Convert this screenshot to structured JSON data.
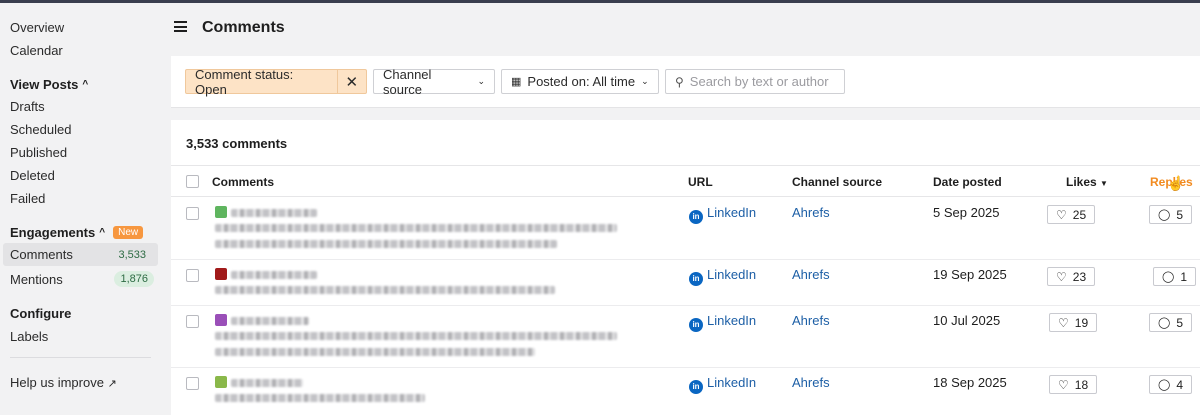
{
  "sidebar": {
    "overview": "Overview",
    "calendar": "Calendar",
    "view_posts": "View Posts",
    "drafts": "Drafts",
    "scheduled": "Scheduled",
    "published": "Published",
    "deleted": "Deleted",
    "failed": "Failed",
    "engagements": "Engagements",
    "new_badge": "New",
    "comments": "Comments",
    "comments_count": "3,533",
    "mentions": "Mentions",
    "mentions_count": "1,876",
    "configure": "Configure",
    "labels": "Labels",
    "help": "Help us improve"
  },
  "header": {
    "title": "Comments"
  },
  "filters": {
    "status": "Comment status: Open",
    "channel": "Channel source",
    "posted": "Posted on: All time",
    "search_placeholder": "Search by text or author"
  },
  "list": {
    "total": "3,533 comments",
    "columns": {
      "comments": "Comments",
      "url": "URL",
      "channel": "Channel source",
      "date": "Date posted",
      "likes": "Likes",
      "replies": "Replies"
    },
    "rows": [
      {
        "url": "LinkedIn",
        "channel": "Ahrefs",
        "date": "5 Sep 2025",
        "likes": "25",
        "replies": "5",
        "avatar_color": "#5fb55f"
      },
      {
        "url": "LinkedIn",
        "channel": "Ahrefs",
        "date": "19 Sep 2025",
        "likes": "23",
        "replies": "1",
        "avatar_color": "#a11a1a"
      },
      {
        "url": "LinkedIn",
        "channel": "Ahrefs",
        "date": "10 Jul 2025",
        "likes": "19",
        "replies": "5",
        "avatar_color": "#9a4fb8"
      },
      {
        "url": "LinkedIn",
        "channel": "Ahrefs",
        "date": "18 Sep 2025",
        "likes": "18",
        "replies": "4",
        "avatar_color": "#8ab84a"
      }
    ]
  }
}
